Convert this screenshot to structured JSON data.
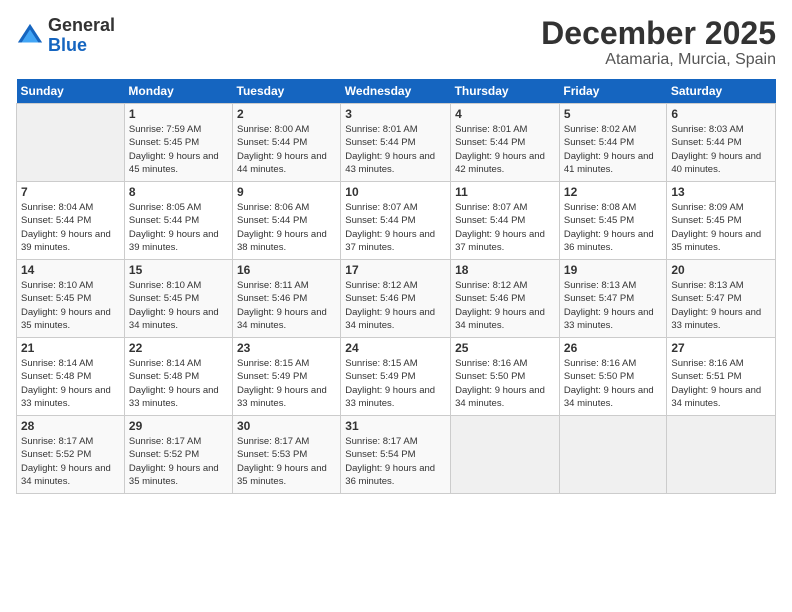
{
  "logo": {
    "general": "General",
    "blue": "Blue"
  },
  "header": {
    "month_year": "December 2025",
    "location": "Atamaria, Murcia, Spain"
  },
  "weekdays": [
    "Sunday",
    "Monday",
    "Tuesday",
    "Wednesday",
    "Thursday",
    "Friday",
    "Saturday"
  ],
  "weeks": [
    [
      {
        "day": "",
        "sunrise": "",
        "sunset": "",
        "daylight": ""
      },
      {
        "day": "1",
        "sunrise": "Sunrise: 7:59 AM",
        "sunset": "Sunset: 5:45 PM",
        "daylight": "Daylight: 9 hours and 45 minutes."
      },
      {
        "day": "2",
        "sunrise": "Sunrise: 8:00 AM",
        "sunset": "Sunset: 5:44 PM",
        "daylight": "Daylight: 9 hours and 44 minutes."
      },
      {
        "day": "3",
        "sunrise": "Sunrise: 8:01 AM",
        "sunset": "Sunset: 5:44 PM",
        "daylight": "Daylight: 9 hours and 43 minutes."
      },
      {
        "day": "4",
        "sunrise": "Sunrise: 8:01 AM",
        "sunset": "Sunset: 5:44 PM",
        "daylight": "Daylight: 9 hours and 42 minutes."
      },
      {
        "day": "5",
        "sunrise": "Sunrise: 8:02 AM",
        "sunset": "Sunset: 5:44 PM",
        "daylight": "Daylight: 9 hours and 41 minutes."
      },
      {
        "day": "6",
        "sunrise": "Sunrise: 8:03 AM",
        "sunset": "Sunset: 5:44 PM",
        "daylight": "Daylight: 9 hours and 40 minutes."
      }
    ],
    [
      {
        "day": "7",
        "sunrise": "Sunrise: 8:04 AM",
        "sunset": "Sunset: 5:44 PM",
        "daylight": "Daylight: 9 hours and 39 minutes."
      },
      {
        "day": "8",
        "sunrise": "Sunrise: 8:05 AM",
        "sunset": "Sunset: 5:44 PM",
        "daylight": "Daylight: 9 hours and 39 minutes."
      },
      {
        "day": "9",
        "sunrise": "Sunrise: 8:06 AM",
        "sunset": "Sunset: 5:44 PM",
        "daylight": "Daylight: 9 hours and 38 minutes."
      },
      {
        "day": "10",
        "sunrise": "Sunrise: 8:07 AM",
        "sunset": "Sunset: 5:44 PM",
        "daylight": "Daylight: 9 hours and 37 minutes."
      },
      {
        "day": "11",
        "sunrise": "Sunrise: 8:07 AM",
        "sunset": "Sunset: 5:44 PM",
        "daylight": "Daylight: 9 hours and 37 minutes."
      },
      {
        "day": "12",
        "sunrise": "Sunrise: 8:08 AM",
        "sunset": "Sunset: 5:45 PM",
        "daylight": "Daylight: 9 hours and 36 minutes."
      },
      {
        "day": "13",
        "sunrise": "Sunrise: 8:09 AM",
        "sunset": "Sunset: 5:45 PM",
        "daylight": "Daylight: 9 hours and 35 minutes."
      }
    ],
    [
      {
        "day": "14",
        "sunrise": "Sunrise: 8:10 AM",
        "sunset": "Sunset: 5:45 PM",
        "daylight": "Daylight: 9 hours and 35 minutes."
      },
      {
        "day": "15",
        "sunrise": "Sunrise: 8:10 AM",
        "sunset": "Sunset: 5:45 PM",
        "daylight": "Daylight: 9 hours and 34 minutes."
      },
      {
        "day": "16",
        "sunrise": "Sunrise: 8:11 AM",
        "sunset": "Sunset: 5:46 PM",
        "daylight": "Daylight: 9 hours and 34 minutes."
      },
      {
        "day": "17",
        "sunrise": "Sunrise: 8:12 AM",
        "sunset": "Sunset: 5:46 PM",
        "daylight": "Daylight: 9 hours and 34 minutes."
      },
      {
        "day": "18",
        "sunrise": "Sunrise: 8:12 AM",
        "sunset": "Sunset: 5:46 PM",
        "daylight": "Daylight: 9 hours and 34 minutes."
      },
      {
        "day": "19",
        "sunrise": "Sunrise: 8:13 AM",
        "sunset": "Sunset: 5:47 PM",
        "daylight": "Daylight: 9 hours and 33 minutes."
      },
      {
        "day": "20",
        "sunrise": "Sunrise: 8:13 AM",
        "sunset": "Sunset: 5:47 PM",
        "daylight": "Daylight: 9 hours and 33 minutes."
      }
    ],
    [
      {
        "day": "21",
        "sunrise": "Sunrise: 8:14 AM",
        "sunset": "Sunset: 5:48 PM",
        "daylight": "Daylight: 9 hours and 33 minutes."
      },
      {
        "day": "22",
        "sunrise": "Sunrise: 8:14 AM",
        "sunset": "Sunset: 5:48 PM",
        "daylight": "Daylight: 9 hours and 33 minutes."
      },
      {
        "day": "23",
        "sunrise": "Sunrise: 8:15 AM",
        "sunset": "Sunset: 5:49 PM",
        "daylight": "Daylight: 9 hours and 33 minutes."
      },
      {
        "day": "24",
        "sunrise": "Sunrise: 8:15 AM",
        "sunset": "Sunset: 5:49 PM",
        "daylight": "Daylight: 9 hours and 33 minutes."
      },
      {
        "day": "25",
        "sunrise": "Sunrise: 8:16 AM",
        "sunset": "Sunset: 5:50 PM",
        "daylight": "Daylight: 9 hours and 34 minutes."
      },
      {
        "day": "26",
        "sunrise": "Sunrise: 8:16 AM",
        "sunset": "Sunset: 5:50 PM",
        "daylight": "Daylight: 9 hours and 34 minutes."
      },
      {
        "day": "27",
        "sunrise": "Sunrise: 8:16 AM",
        "sunset": "Sunset: 5:51 PM",
        "daylight": "Daylight: 9 hours and 34 minutes."
      }
    ],
    [
      {
        "day": "28",
        "sunrise": "Sunrise: 8:17 AM",
        "sunset": "Sunset: 5:52 PM",
        "daylight": "Daylight: 9 hours and 34 minutes."
      },
      {
        "day": "29",
        "sunrise": "Sunrise: 8:17 AM",
        "sunset": "Sunset: 5:52 PM",
        "daylight": "Daylight: 9 hours and 35 minutes."
      },
      {
        "day": "30",
        "sunrise": "Sunrise: 8:17 AM",
        "sunset": "Sunset: 5:53 PM",
        "daylight": "Daylight: 9 hours and 35 minutes."
      },
      {
        "day": "31",
        "sunrise": "Sunrise: 8:17 AM",
        "sunset": "Sunset: 5:54 PM",
        "daylight": "Daylight: 9 hours and 36 minutes."
      },
      {
        "day": "",
        "sunrise": "",
        "sunset": "",
        "daylight": ""
      },
      {
        "day": "",
        "sunrise": "",
        "sunset": "",
        "daylight": ""
      },
      {
        "day": "",
        "sunrise": "",
        "sunset": "",
        "daylight": ""
      }
    ]
  ]
}
